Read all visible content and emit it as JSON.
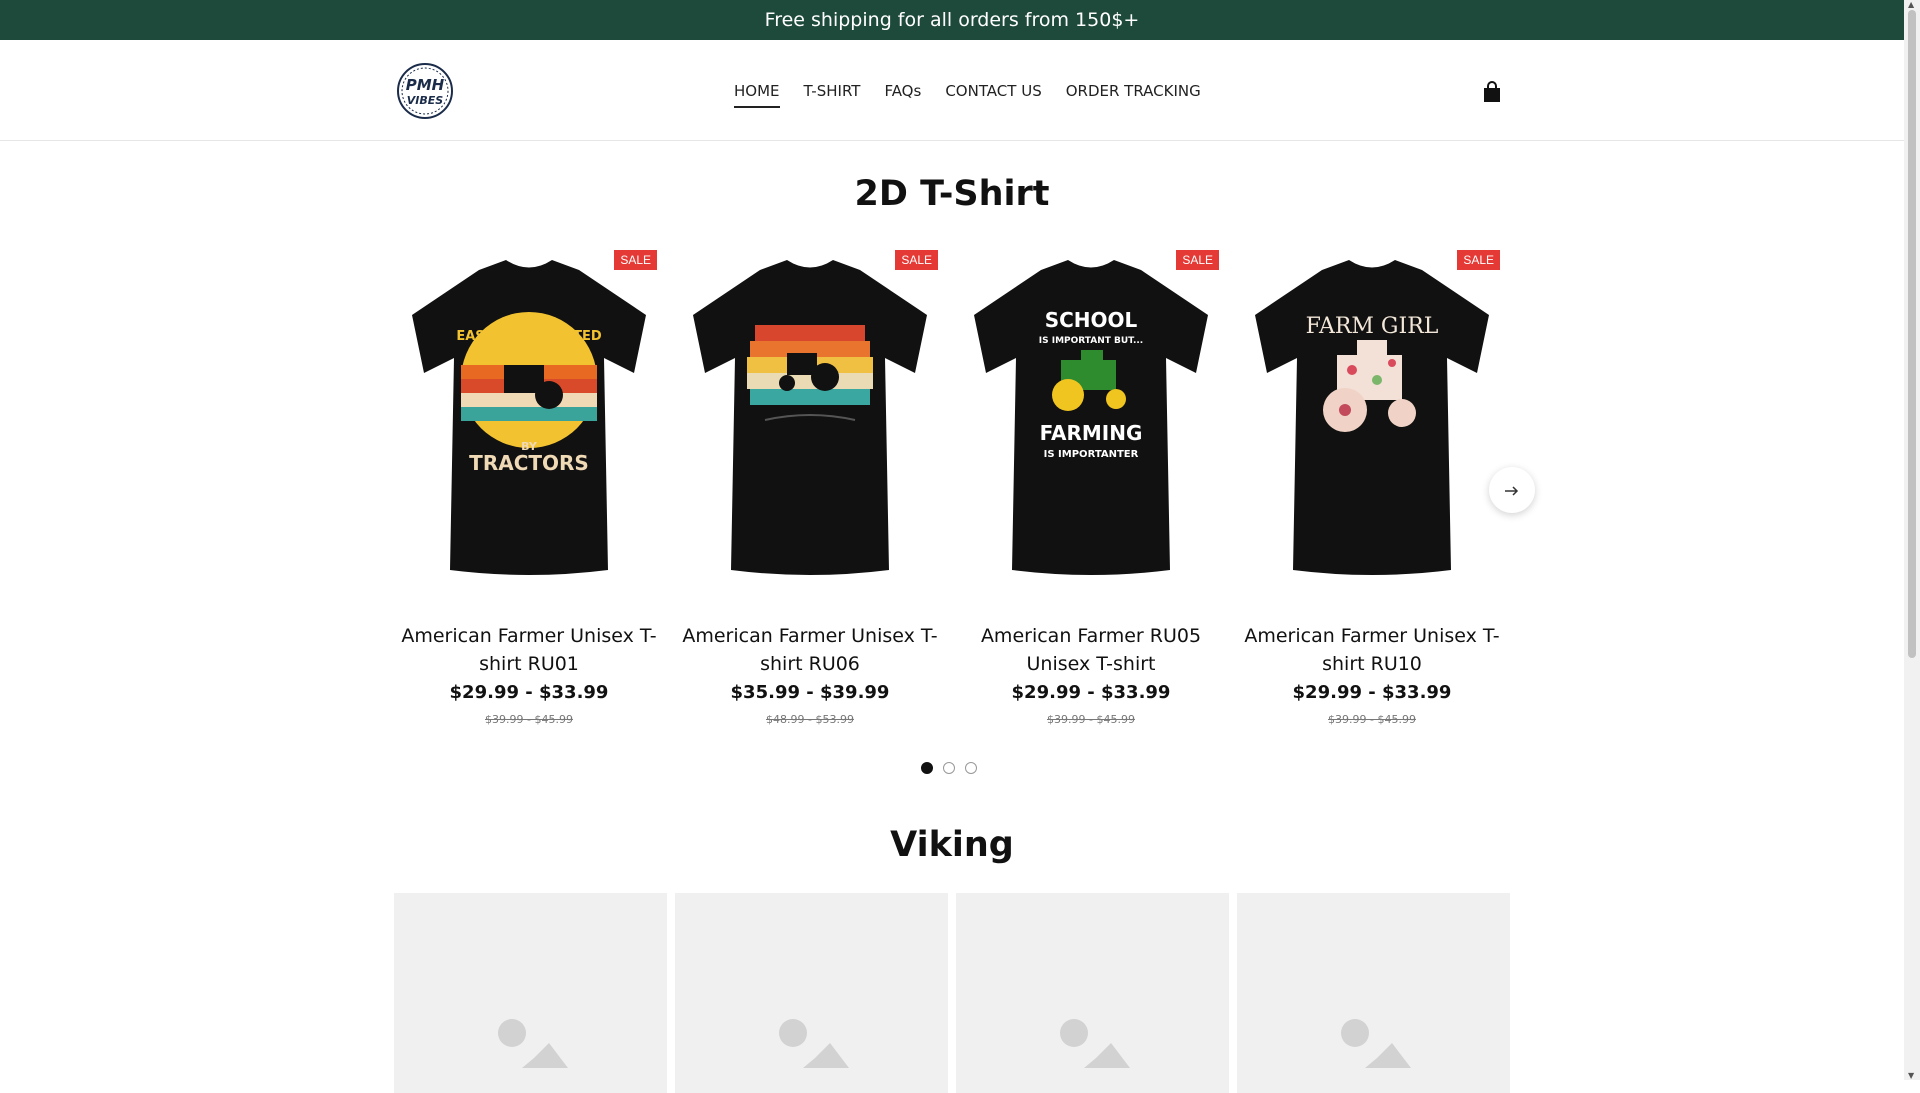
{
  "announcement": "Free shipping for all orders from 150$+",
  "header": {
    "logo_text": "PMH VIBES",
    "nav": [
      "HOME",
      "T-SHIRT",
      "FAQs",
      "CONTACT US",
      "ORDER TRACKING"
    ]
  },
  "section1": {
    "title": "2D T-Shirt",
    "badge": "SALE",
    "products": [
      {
        "title": "American Farmer Unisex T-shirt RU01",
        "price": "$29.99 - $33.99",
        "old_price": "$39.99 - $45.99",
        "art": "EASILY DISTRACTED BY TRACTORS"
      },
      {
        "title": "American Farmer Unisex T-shirt RU06",
        "price": "$35.99 - $39.99",
        "old_price": "$48.99 - $53.99",
        "art": ""
      },
      {
        "title": "American Farmer RU05 Unisex T-shirt",
        "price": "$29.99 - $33.99",
        "old_price": "$39.99 - $45.99",
        "art": "SCHOOL IS IMPORTANT BUT... FARMING IS IMPORTANTER"
      },
      {
        "title": "American Farmer Unisex T-shirt RU10",
        "price": "$29.99 - $33.99",
        "old_price": "$39.99 - $45.99",
        "art": "FARM GIRL"
      }
    ],
    "dots_active": 0,
    "dots_count": 3
  },
  "section2": {
    "title": "Viking"
  },
  "colors": {
    "announce_bg": "#1e4a3c",
    "sale_badge": "#e53935"
  }
}
